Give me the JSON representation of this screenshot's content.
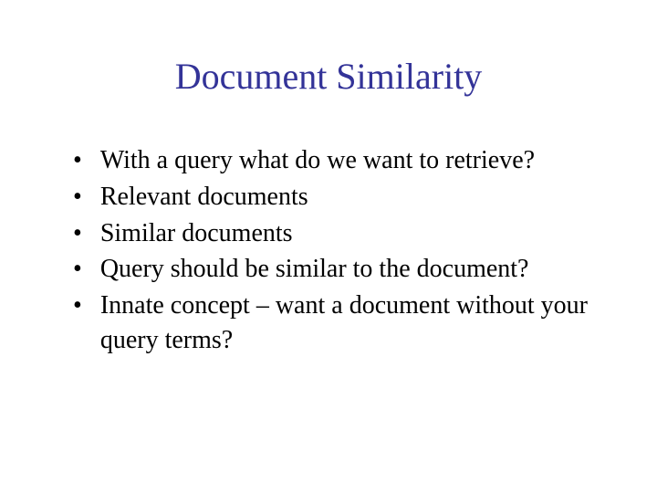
{
  "slide": {
    "title": "Document Similarity",
    "bullets": [
      "With a query what do we want to retrieve?",
      "Relevant documents",
      "Similar documents",
      "Query should be similar to the document?",
      "Innate concept – want a document without your query terms?"
    ]
  }
}
